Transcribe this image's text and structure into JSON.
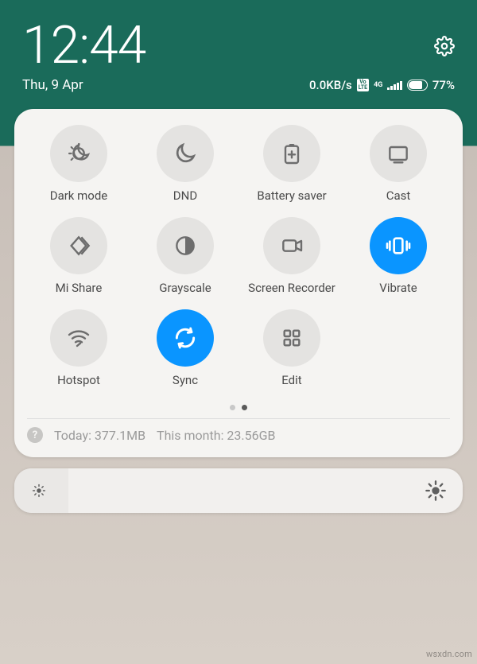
{
  "status": {
    "time": "12:44",
    "date": "Thu, 9 Apr",
    "net_speed": "0.0KB/s",
    "volte": "VoLTE",
    "network_type": "4G",
    "battery_percent": "77%",
    "battery_fill_pct": 77
  },
  "tiles": [
    {
      "id": "dark-mode",
      "label": "Dark mode",
      "icon": "dark-mode-icon",
      "active": false
    },
    {
      "id": "dnd",
      "label": "DND",
      "icon": "moon-icon",
      "active": false
    },
    {
      "id": "battery-saver",
      "label": "Battery saver",
      "icon": "battery-plus-icon",
      "active": false
    },
    {
      "id": "cast",
      "label": "Cast",
      "icon": "cast-icon",
      "active": false
    },
    {
      "id": "mi-share",
      "label": "Mi Share",
      "icon": "share-diamond-icon",
      "active": false
    },
    {
      "id": "grayscale",
      "label": "Grayscale",
      "icon": "half-circle-icon",
      "active": false
    },
    {
      "id": "screen-recorder",
      "label": "Screen Recorder",
      "icon": "video-camera-icon",
      "active": false
    },
    {
      "id": "vibrate",
      "label": "Vibrate",
      "icon": "vibrate-icon",
      "active": true
    },
    {
      "id": "hotspot",
      "label": "Hotspot",
      "icon": "wifi-hotspot-icon",
      "active": false
    },
    {
      "id": "sync",
      "label": "Sync",
      "icon": "sync-icon",
      "active": true
    },
    {
      "id": "edit",
      "label": "Edit",
      "icon": "grid-icon",
      "active": false
    }
  ],
  "pagination": {
    "total": 2,
    "current": 2
  },
  "data_usage": {
    "today_label": "Today:",
    "today_value": "377.1MB",
    "month_label": "This month:",
    "month_value": "23.56GB"
  },
  "brightness": {
    "level_pct": 12
  },
  "watermark": "wsxdn.com"
}
